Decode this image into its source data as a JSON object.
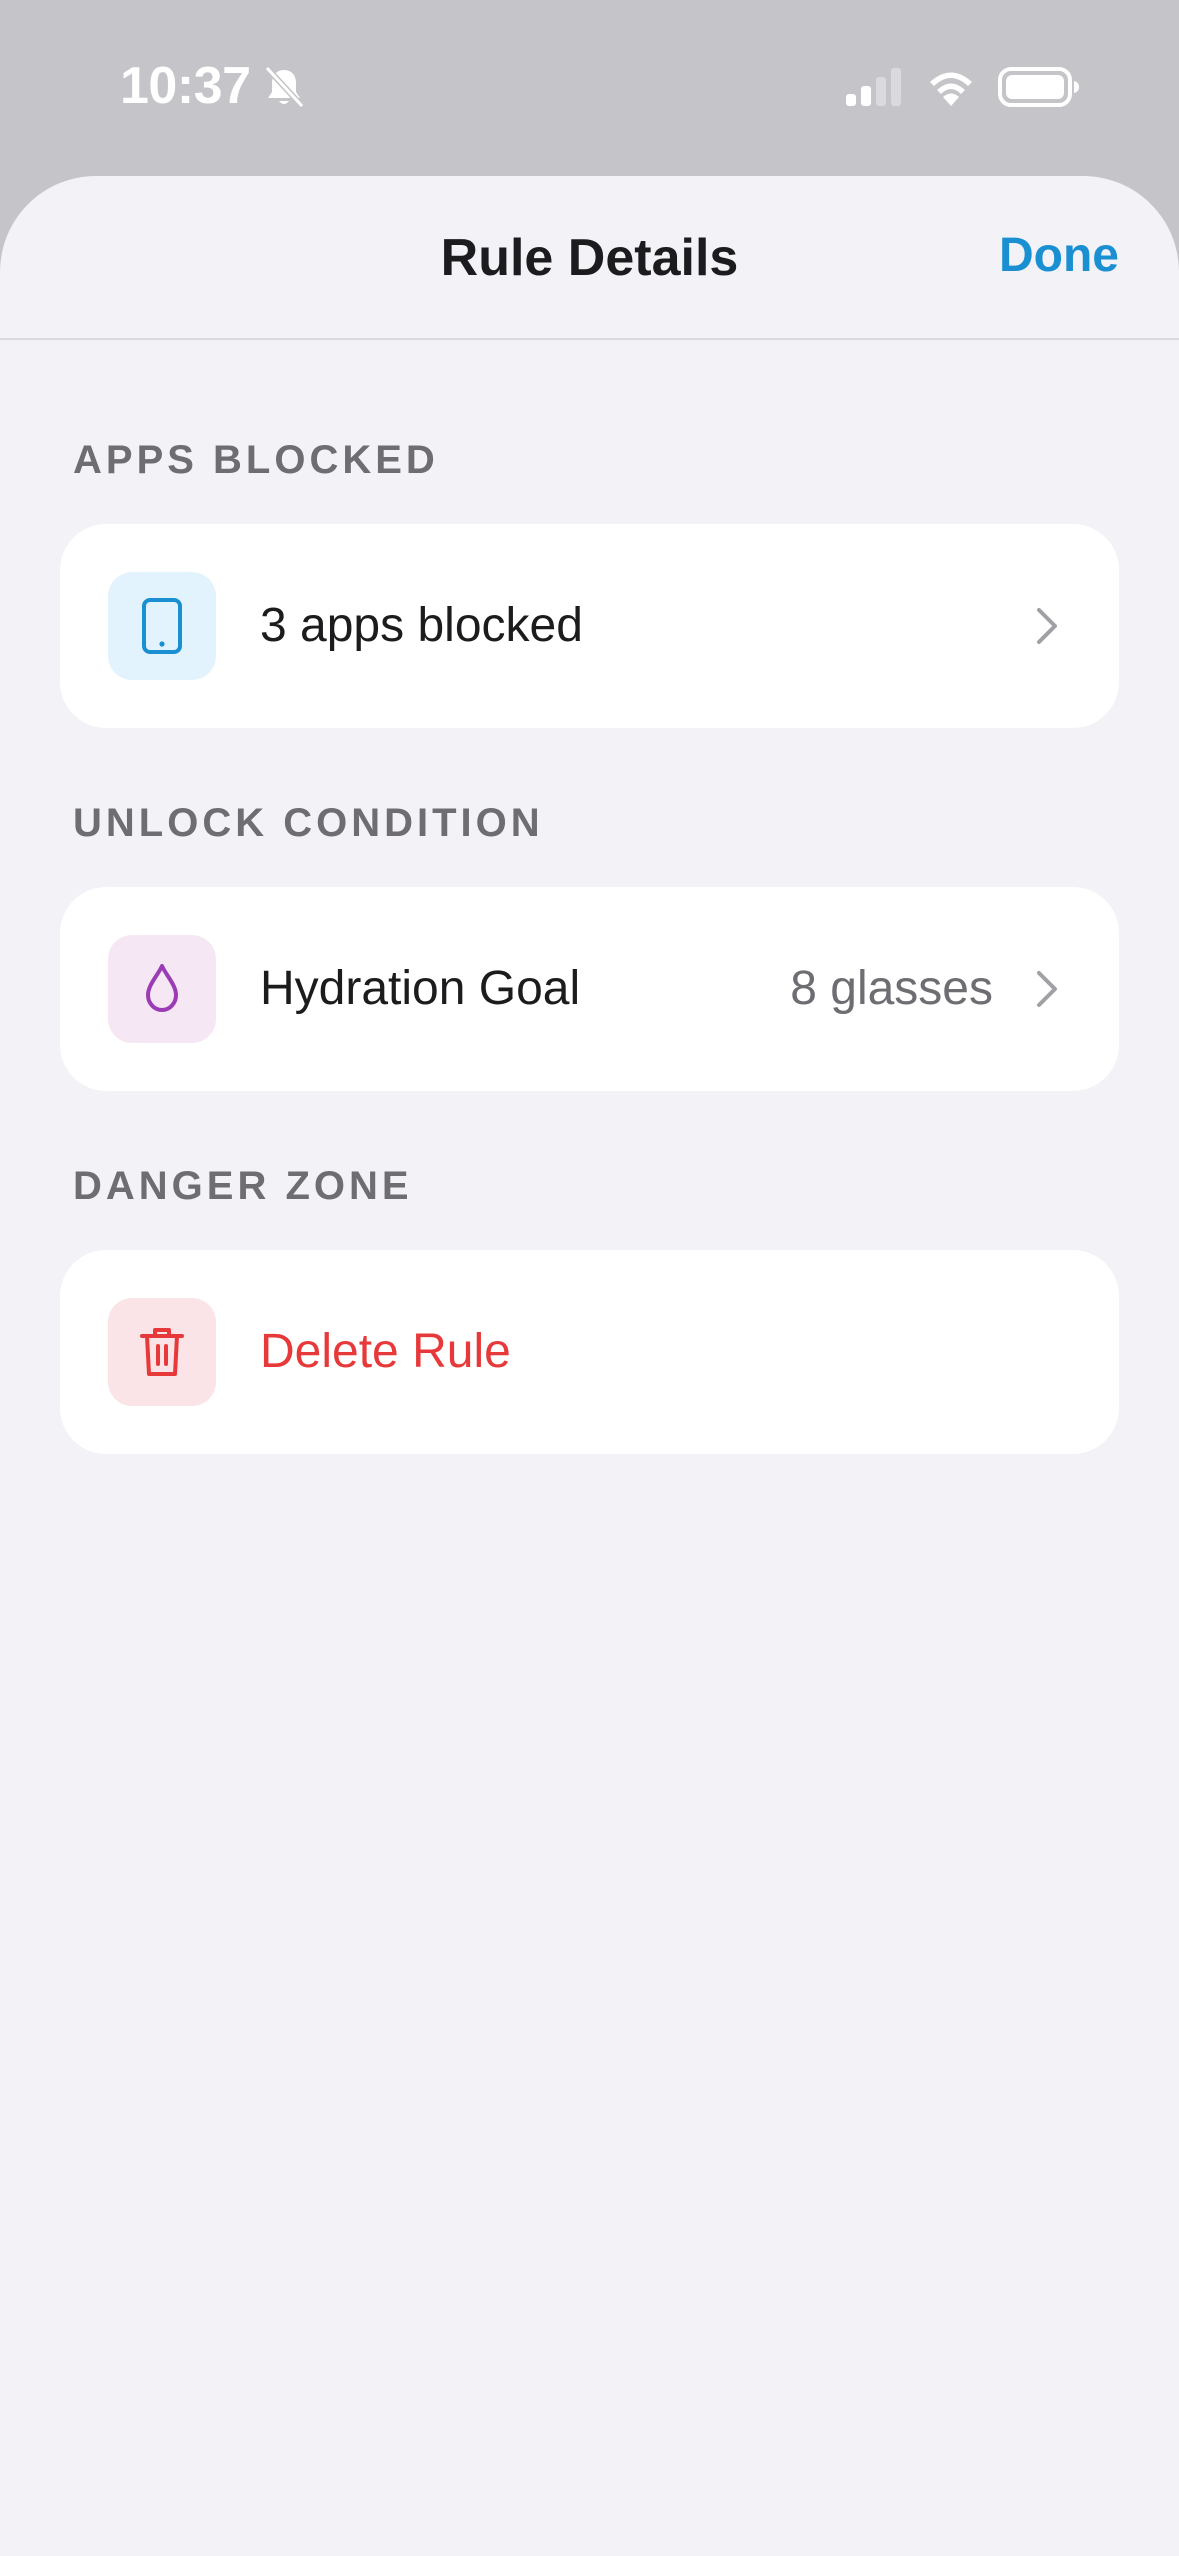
{
  "status_bar": {
    "time": "10:37",
    "icons": [
      "bell-slash-icon",
      "cellular-signal-icon",
      "wifi-icon",
      "battery-icon"
    ]
  },
  "nav": {
    "title": "Rule Details",
    "done_label": "Done"
  },
  "sections": {
    "apps": {
      "header": "APPS BLOCKED",
      "row_label": "3 apps blocked",
      "icon": "phone-icon"
    },
    "unlock": {
      "header": "UNLOCK CONDITION",
      "row_label": "Hydration Goal",
      "row_value": "8 glasses",
      "icon": "water-drop-icon"
    },
    "danger": {
      "header": "DANGER ZONE",
      "row_label": "Delete Rule",
      "icon": "trash-icon"
    }
  },
  "colors": {
    "accent": "#1a8fd2",
    "danger": "#e8393a",
    "hydration": "#9b3bb5",
    "background": "#f2f2f7"
  }
}
